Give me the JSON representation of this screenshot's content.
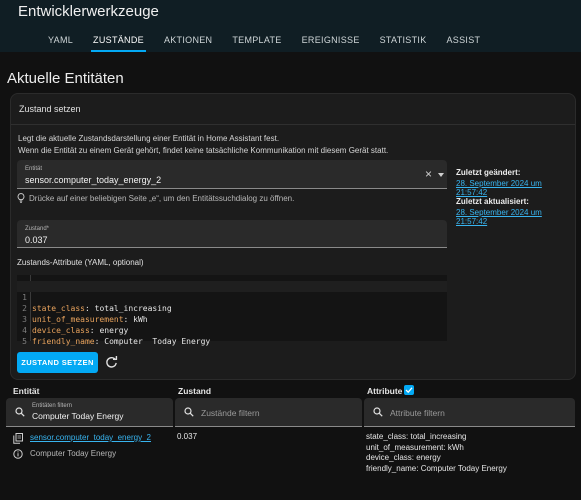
{
  "header": {
    "title": "Entwicklerwerkzeuge",
    "tabs": [
      "YAML",
      "ZUSTÄNDE",
      "AKTIONEN",
      "TEMPLATE",
      "EREIGNISSE",
      "STATISTIK",
      "ASSIST"
    ],
    "active_tab": "ZUSTÄNDE",
    "accent_color": "#03a9f4"
  },
  "page_title": "Aktuelle Entitäten",
  "set_state": {
    "title": "Zustand setzen",
    "description_line1": "Legt die aktuelle Zustandsdarstellung einer Entität in Home Assistant fest.",
    "description_line2": "Wenn die Entität zu einem Gerät gehört, findet keine tatsächliche Kommunikation mit diesem Gerät statt.",
    "entity_label": "Entität",
    "entity_value": "sensor.computer_today_energy_2",
    "hint": "Drücke auf einer beliebigen Seite „e“, um den Entitätssuchdialog zu öffnen.",
    "state_label": "Zustand*",
    "state_value": "0.037",
    "attributes_label": "Zustands-Attribute (YAML, optional)",
    "yaml_lines": [
      {
        "num": "1",
        "key": "state_class",
        "value": " total_increasing"
      },
      {
        "num": "2",
        "key": "unit_of_measurement",
        "value": " kWh"
      },
      {
        "num": "3",
        "key": "device_class",
        "value": " energy"
      },
      {
        "num": "4",
        "key": "friendly_name",
        "value": " Computer  Today Energy"
      },
      {
        "num": "5",
        "key": "",
        "value": ""
      }
    ],
    "submit_button": "ZUSTAND SETZEN",
    "last_changed_label": "Zuletzt geändert:",
    "last_changed_value": "28. September 2024 um 21:57:42",
    "last_updated_label": "Zuletzt aktualisiert:",
    "last_updated_value": "28. September 2024 um 21:57:42"
  },
  "table": {
    "col_entity": "Entität",
    "col_state": "Zustand",
    "col_attributes": "Attribute",
    "attributes_checked": true,
    "filter_entity_label": "Entitäten filtern",
    "filter_entity_value": "Computer  Today Energy",
    "filter_state_placeholder": "Zustände filtern",
    "filter_attr_placeholder": "Attribute filtern",
    "row": {
      "entity_id": "sensor.computer_today_energy_2",
      "friendly_name": "Computer  Today Energy",
      "state": "0.037",
      "attributes": [
        "state_class: total_increasing",
        "unit_of_measurement: kWh",
        "device_class: energy",
        "friendly_name: Computer  Today Energy"
      ]
    }
  }
}
